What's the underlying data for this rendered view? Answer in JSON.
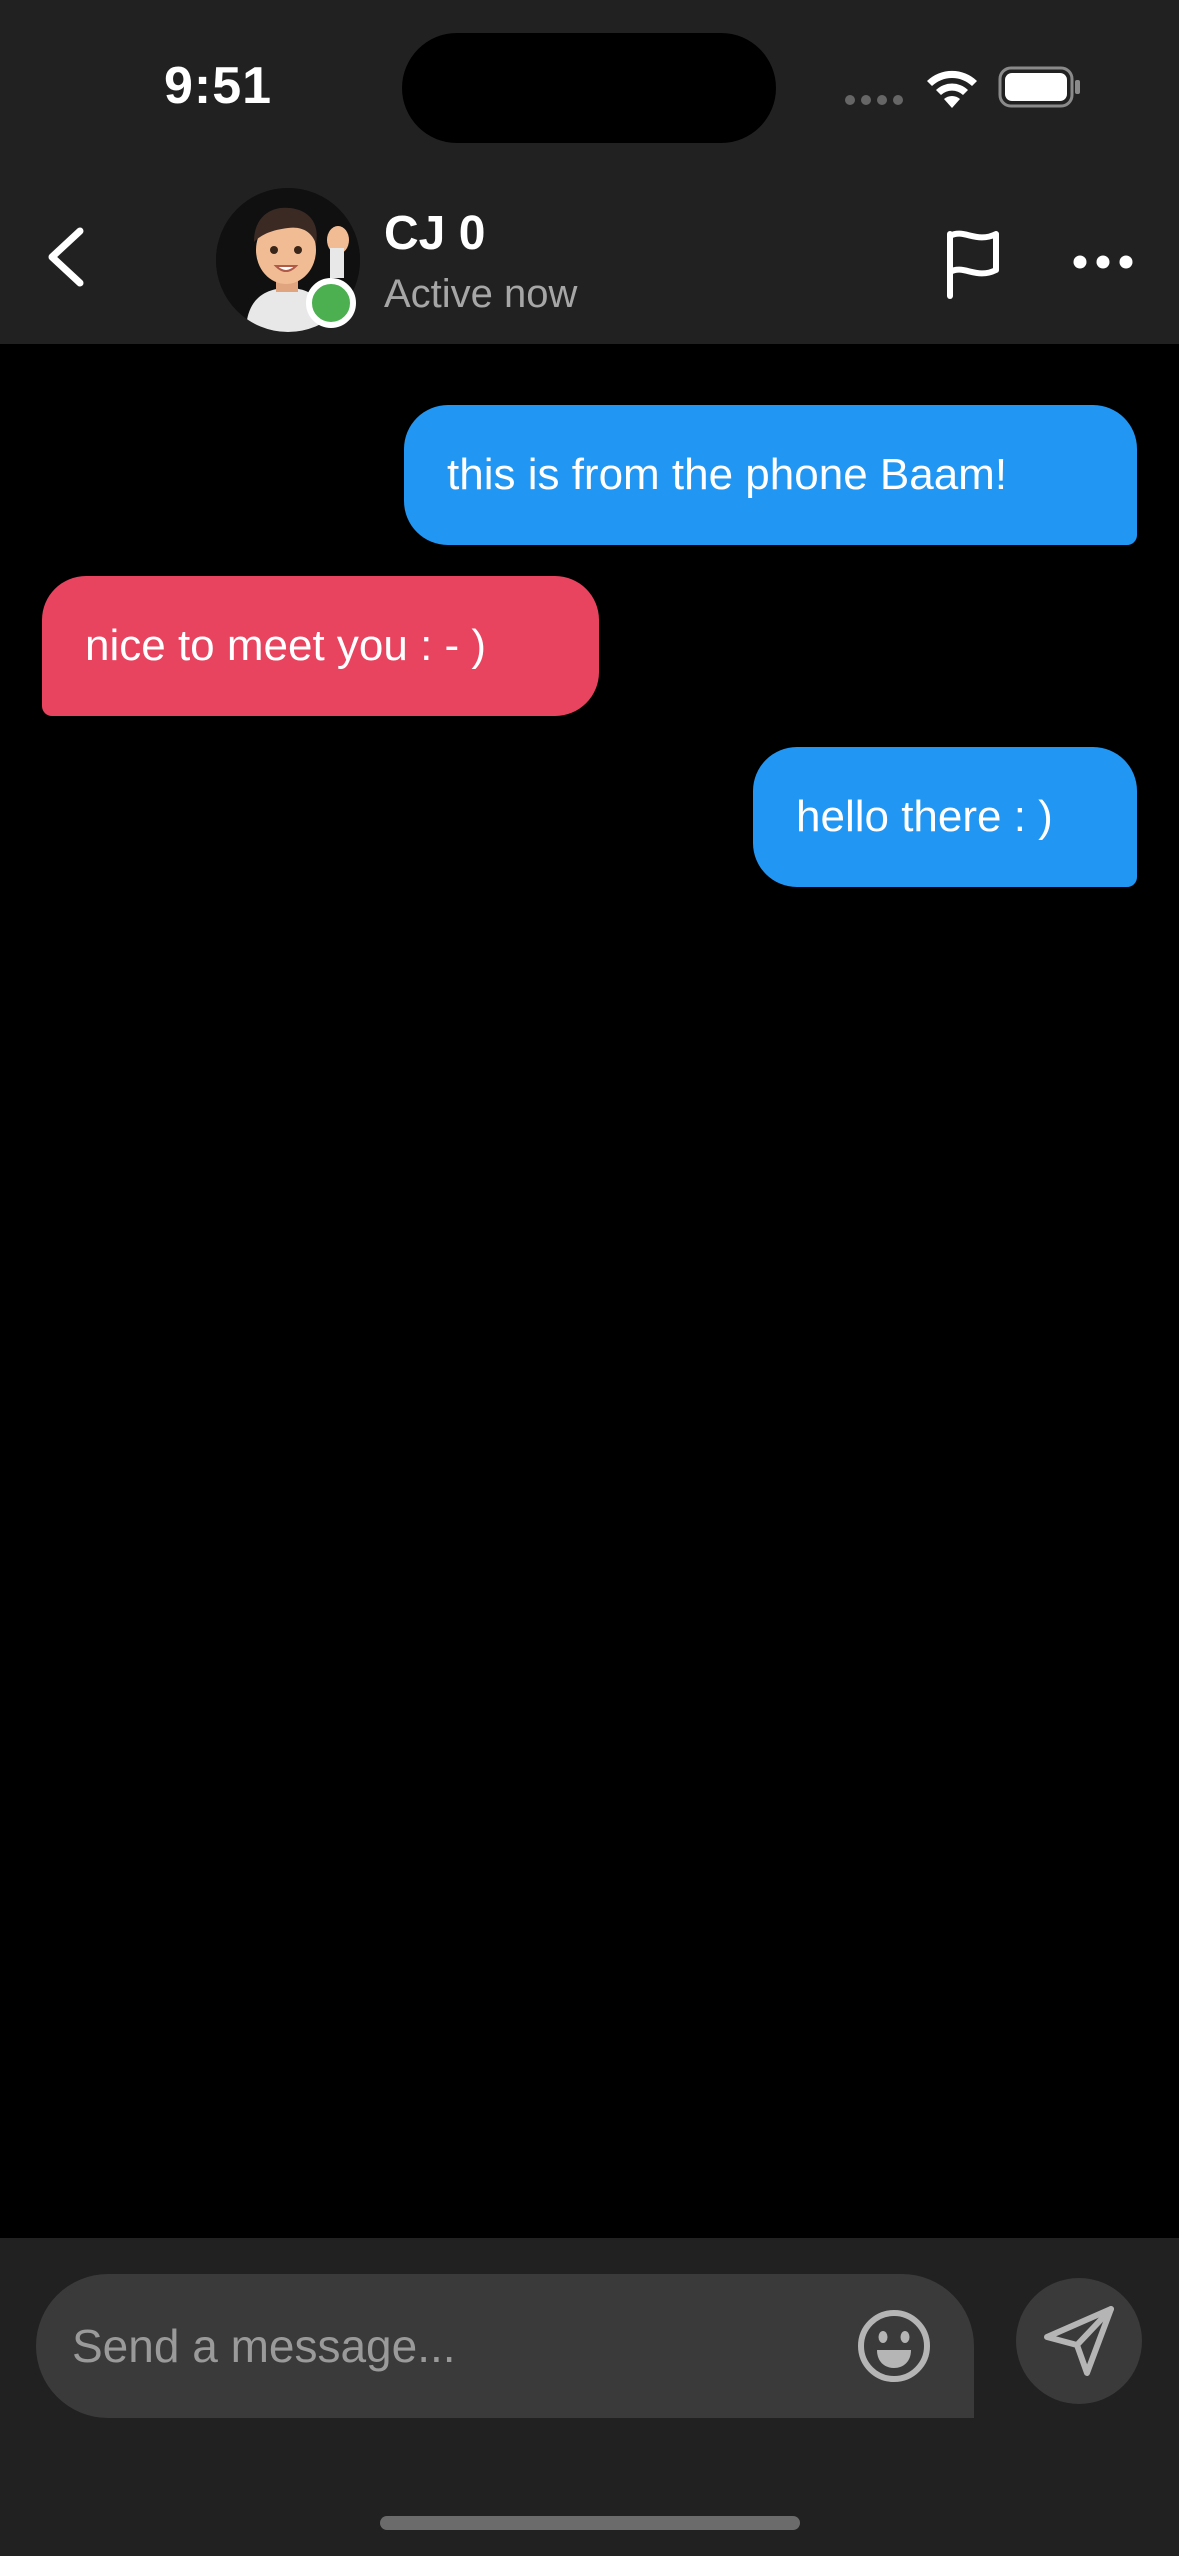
{
  "status_bar": {
    "time": "9:51"
  },
  "header": {
    "back_icon": "chevron-left-icon",
    "contact_name": "CJ 0",
    "contact_status": "Active now",
    "online_color": "#4caf50",
    "flag_icon": "flag-icon",
    "more_icon": "ellipsis-icon"
  },
  "messages": [
    {
      "text": "this is from the phone Baam!",
      "direction": "outgoing"
    },
    {
      "text": "nice to meet you : - )",
      "direction": "incoming"
    },
    {
      "text": "hello there : )",
      "direction": "outgoing"
    }
  ],
  "composer": {
    "placeholder": "Send a message...",
    "value": "",
    "emoji_icon": "smiley-icon",
    "send_icon": "paper-plane-icon"
  },
  "colors": {
    "outgoing_bubble": "#2196f3",
    "incoming_bubble": "#e8445f",
    "bar_background": "#212121",
    "chat_background": "#000000"
  }
}
